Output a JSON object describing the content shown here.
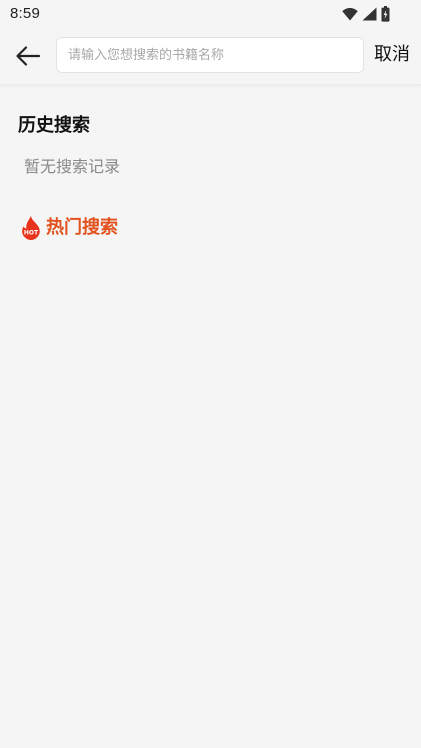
{
  "status_bar": {
    "time": "8:59"
  },
  "header": {
    "search_placeholder": "请输入您想搜索的书籍名称",
    "search_value": "",
    "cancel_label": "取消"
  },
  "history": {
    "title": "历史搜索",
    "empty_text": "暂无搜索记录"
  },
  "hot": {
    "title": "热门搜索",
    "icon_badge": "HOT"
  },
  "colors": {
    "background": "#f5f5f5",
    "accent": "#e2521f",
    "hot_icon": "#e8341c"
  },
  "icons": {
    "back": "arrow-left-icon",
    "wifi": "wifi-icon",
    "signal": "signal-icon",
    "battery": "battery-icon",
    "hot": "flame-icon"
  }
}
